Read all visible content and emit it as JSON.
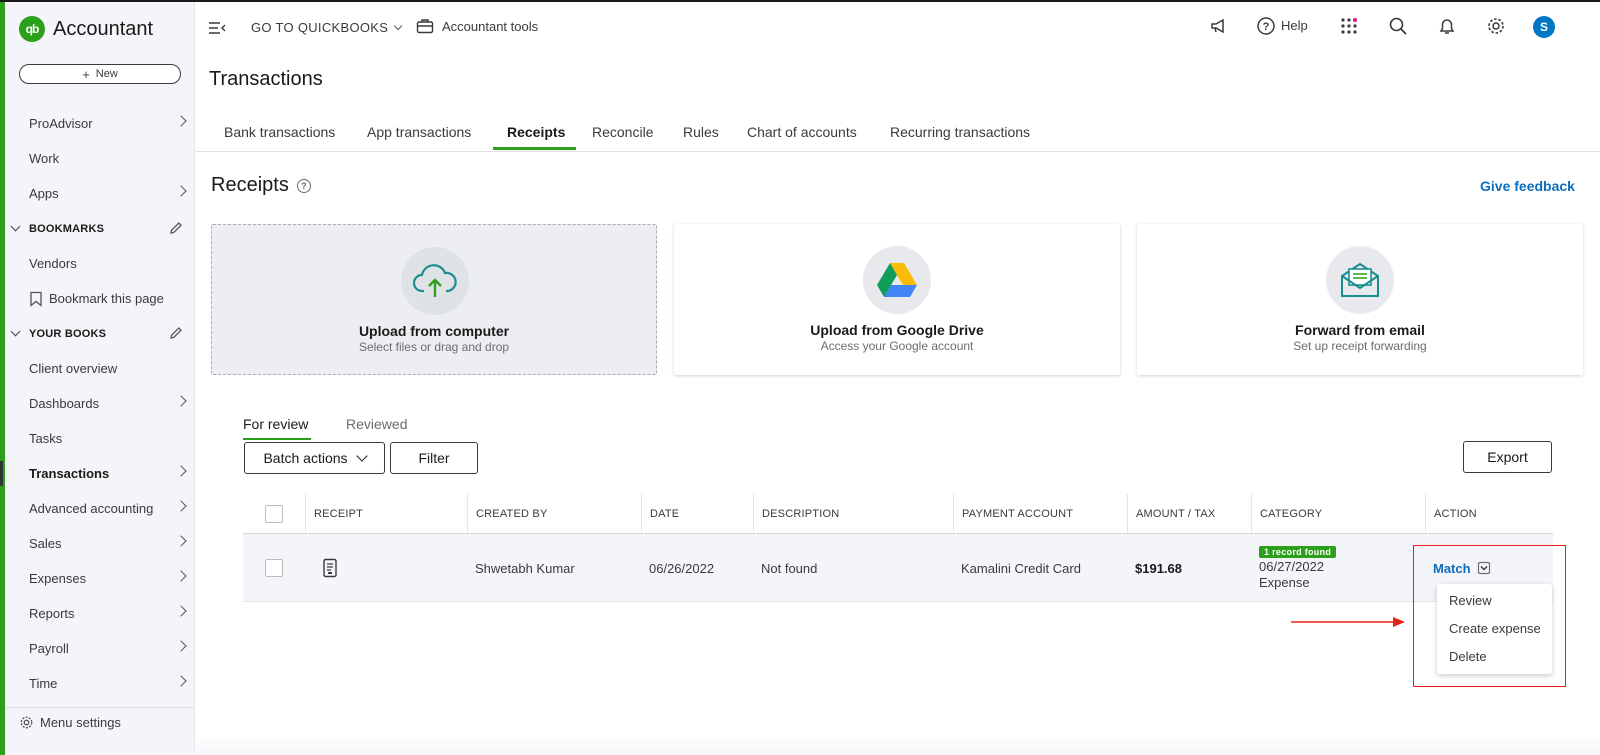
{
  "app": {
    "brand": "Accountant",
    "logo_text": "qb",
    "new_button": "New",
    "menu_settings": "Menu settings"
  },
  "sidebar": {
    "items": [
      {
        "label": "ProAdvisor",
        "chevron": true
      },
      {
        "label": "Work",
        "chevron": false
      },
      {
        "label": "Apps",
        "chevron": true
      }
    ],
    "bookmarks_header": "BOOKMARKS",
    "bookmarks": [
      {
        "label": "Vendors"
      },
      {
        "label": "Bookmark this page"
      }
    ],
    "books_header": "YOUR BOOKS",
    "books": [
      {
        "label": "Client overview",
        "chevron": false
      },
      {
        "label": "Dashboards",
        "chevron": true
      },
      {
        "label": "Tasks",
        "chevron": false
      },
      {
        "label": "Transactions",
        "chevron": true,
        "active": true
      },
      {
        "label": "Advanced accounting",
        "chevron": true
      },
      {
        "label": "Sales",
        "chevron": true
      },
      {
        "label": "Expenses",
        "chevron": true
      },
      {
        "label": "Reports",
        "chevron": true
      },
      {
        "label": "Payroll",
        "chevron": true
      },
      {
        "label": "Time",
        "chevron": true
      }
    ]
  },
  "topbar": {
    "goto": "GO TO QUICKBOOKS",
    "accountant_tools": "Accountant tools",
    "help": "Help",
    "avatar": "S"
  },
  "page": {
    "title": "Transactions",
    "tabs": [
      "Bank transactions",
      "App transactions",
      "Receipts",
      "Reconcile",
      "Rules",
      "Chart of accounts",
      "Recurring transactions"
    ],
    "active_tab": "Receipts"
  },
  "receipts": {
    "title": "Receipts",
    "help_glyph": "?",
    "give_feedback": "Give feedback",
    "cards": [
      {
        "title": "Upload from computer",
        "subtitle": "Select files or drag and drop",
        "icon": "cloud-upload-icon"
      },
      {
        "title": "Upload from Google Drive",
        "subtitle": "Access your Google account",
        "icon": "google-drive-icon"
      },
      {
        "title": "Forward from email",
        "subtitle": "Set up receipt forwarding",
        "icon": "email-receipt-icon"
      }
    ],
    "review_tabs": [
      "For review",
      "Reviewed"
    ],
    "batch_actions": "Batch actions",
    "filter": "Filter",
    "export": "Export"
  },
  "table": {
    "columns": [
      "RECEIPT",
      "CREATED BY",
      "DATE",
      "DESCRIPTION",
      "PAYMENT ACCOUNT",
      "AMOUNT / TAX",
      "CATEGORY",
      "ACTION"
    ],
    "rows": [
      {
        "created_by": "Shwetabh Kumar",
        "date": "06/26/2022",
        "description": "Not found",
        "payment_account": "Kamalini Credit Card",
        "amount": "$191.68",
        "category_badge": "1 record found",
        "category_date": "06/27/2022",
        "category_type": "Expense",
        "action": "Match"
      }
    ]
  },
  "action_menu": [
    "Review",
    "Create expense",
    "Delete"
  ],
  "colors": {
    "brand_green": "#2ca01c",
    "link_blue": "#0d6dbd",
    "annotation_red": "#e8221b"
  }
}
